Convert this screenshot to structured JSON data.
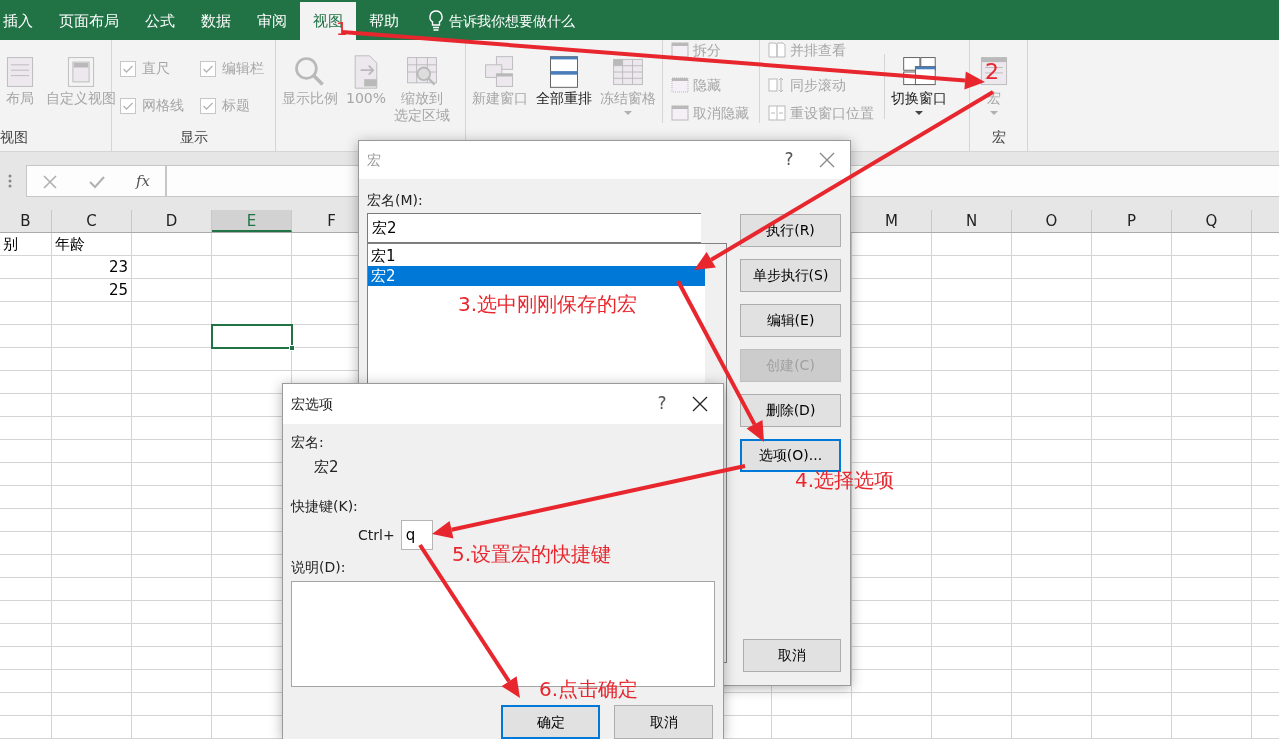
{
  "ribbon_tabs": [
    {
      "label": "插入",
      "selected": false
    },
    {
      "label": "页面布局",
      "selected": false
    },
    {
      "label": "公式",
      "selected": false
    },
    {
      "label": "数据",
      "selected": false
    },
    {
      "label": "审阅",
      "selected": false
    },
    {
      "label": "视图",
      "selected": true
    },
    {
      "label": "帮助",
      "selected": false
    }
  ],
  "tell_me": "告诉我你想要做什么",
  "ribbon_groups": [
    {
      "label": "视图",
      "commands": [
        {
          "kind": "large",
          "label": "布局",
          "disabled": true,
          "caret": false
        },
        {
          "kind": "large",
          "label": "自定义视图",
          "disabled": true,
          "caret": false
        }
      ]
    },
    {
      "label": "显示",
      "commands": [
        {
          "kind": "check",
          "label": "直尺",
          "checked": true,
          "disabled": true
        },
        {
          "kind": "check",
          "label": "编辑栏",
          "checked": true,
          "disabled": true
        },
        {
          "kind": "check",
          "label": "网格线",
          "checked": true,
          "disabled": true
        },
        {
          "kind": "check",
          "label": "标题",
          "checked": true,
          "disabled": true
        }
      ]
    },
    {
      "commands": [
        {
          "kind": "large",
          "label": "显示比例",
          "disabled": true,
          "caret": false
        },
        {
          "kind": "large",
          "label": "100%",
          "disabled": true,
          "caret": false
        },
        {
          "kind": "large",
          "lines": [
            "缩放到",
            "选定区域"
          ],
          "disabled": true,
          "caret": false
        }
      ]
    },
    {
      "commands": [
        {
          "kind": "large",
          "label": "新建窗口",
          "disabled": true,
          "caret": false
        },
        {
          "kind": "large",
          "label": "全部重排",
          "disabled": false,
          "caret": false
        },
        {
          "kind": "large",
          "label": "冻结窗格",
          "disabled": true,
          "caret": true
        },
        {
          "kind": "small",
          "label": "拆分",
          "disabled": true
        },
        {
          "kind": "small",
          "label": "隐藏",
          "disabled": true
        },
        {
          "kind": "small",
          "label": "取消隐藏",
          "disabled": true
        },
        {
          "kind": "small",
          "label": "并排查看",
          "disabled": true
        },
        {
          "kind": "small",
          "label": "同步滚动",
          "disabled": true
        },
        {
          "kind": "small",
          "label": "重设窗口位置",
          "disabled": true
        },
        {
          "kind": "large",
          "label": "切换窗口",
          "disabled": false,
          "caret": true
        }
      ]
    },
    {
      "label": "宏",
      "commands": [
        {
          "kind": "large",
          "label": "宏",
          "disabled": true,
          "caret": true
        }
      ]
    }
  ],
  "formula_bar": {
    "function_label": "fx"
  },
  "sheet": {
    "columns": [
      {
        "label": "B",
        "selected": false
      },
      {
        "label": "C",
        "selected": false
      },
      {
        "label": "D",
        "selected": false
      },
      {
        "label": "E",
        "selected": true
      },
      {
        "label": "F",
        "selected": false
      },
      {
        "label": "M",
        "selected": false
      },
      {
        "label": "N",
        "selected": false
      },
      {
        "label": "O",
        "selected": false
      },
      {
        "label": "P",
        "selected": false
      },
      {
        "label": "Q",
        "selected": false
      }
    ],
    "rows": [
      {
        "cells": {
          "B": {
            "text": "别",
            "selected": false
          },
          "C": {
            "text": "年龄",
            "selected": false
          }
        }
      },
      {
        "cells": {
          "C": {
            "text": "23",
            "kind": "number",
            "selected": false
          }
        }
      },
      {
        "cells": {
          "C": {
            "text": "25",
            "kind": "number",
            "selected": false
          }
        }
      },
      {},
      {
        "cells": {
          "E": {
            "selected": true
          }
        }
      }
    ]
  },
  "macro_dialog": {
    "title": "宏",
    "active": false,
    "help_button": "?",
    "name_label": "宏名(M):",
    "name_value": "宏2",
    "macros": [
      {
        "name": "宏1",
        "selected": false
      },
      {
        "name": "宏2",
        "selected": true
      }
    ],
    "buttons": [
      {
        "label": "执行(R)",
        "kind": "stack",
        "disabled": false,
        "focused": false
      },
      {
        "label": "单步执行(S)",
        "kind": "stack",
        "disabled": false,
        "focused": false
      },
      {
        "label": "编辑(E)",
        "kind": "stack",
        "disabled": false,
        "focused": false
      },
      {
        "label": "创建(C)",
        "kind": "stack",
        "disabled": true,
        "focused": false
      },
      {
        "label": "删除(D)",
        "kind": "stack",
        "disabled": false,
        "focused": false
      },
      {
        "label": "选项(O)...",
        "kind": "stack",
        "disabled": false,
        "focused": true
      },
      {
        "label": "取消",
        "kind": "bottom",
        "disabled": false,
        "focused": false
      }
    ]
  },
  "options_dialog": {
    "title": "宏选项",
    "active": true,
    "help_button": "?",
    "name_label": "宏名:",
    "name_value": "宏2",
    "shortcut_label": "快捷键(K):",
    "shortcut_prefix": "Ctrl+",
    "shortcut_value": "q",
    "description_label": "说明(D):",
    "buttons": [
      {
        "label": "确定",
        "focused": true
      },
      {
        "label": "取消",
        "focused": false
      }
    ]
  },
  "annotations": [
    {
      "text": "1"
    },
    {
      "text": "2"
    },
    {
      "text": "3.选中刚刚保存的宏"
    },
    {
      "text": "4.选择选项"
    },
    {
      "text": "5.设置宏的快捷键"
    },
    {
      "text": "6.点击确定"
    }
  ]
}
